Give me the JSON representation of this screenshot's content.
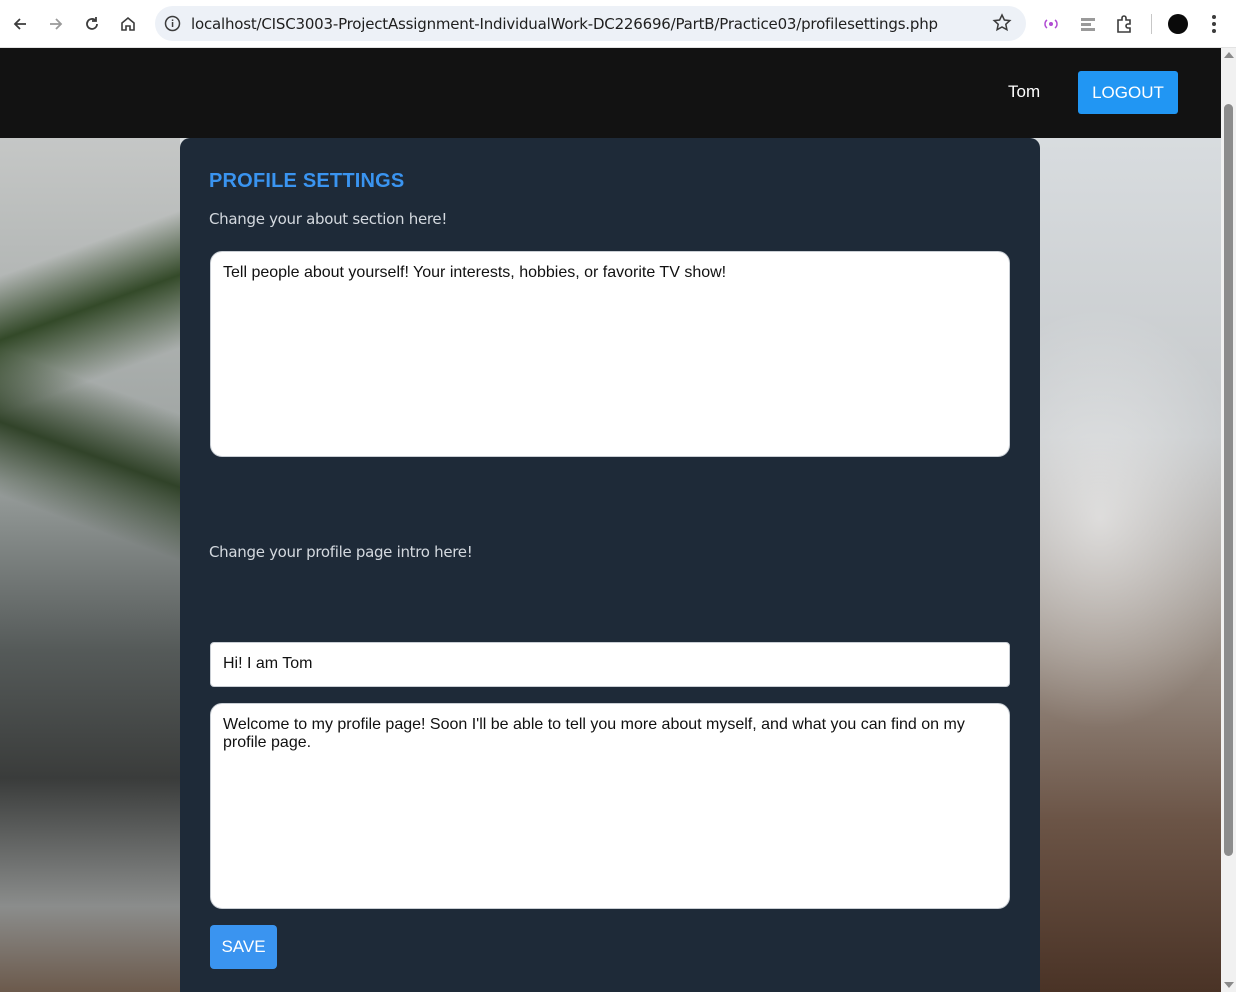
{
  "browser": {
    "url": "localhost/CISC3003-ProjectAssignment-IndividualWork-DC226696/PartB/Practice03/profilesettings.php",
    "icons": [
      "back-icon",
      "forward-icon",
      "reload-icon",
      "home-icon",
      "site-info-icon",
      "bookmark-star-icon",
      "media-cast-icon",
      "extension-puzzle-icon",
      "profile-avatar-icon",
      "menu-kebab-icon"
    ]
  },
  "header": {
    "username": "Tom",
    "logout_label": "LOGOUT"
  },
  "settings": {
    "title": "PROFILE SETTINGS",
    "about_label": "Change your about section here!",
    "about_text": "Tell people about yourself! Your interests, hobbies, or favorite TV show!",
    "intro_label": "Change your profile page intro here!",
    "intro_title": "Hi! I am Tom",
    "intro_text": "Welcome to my profile page! Soon I'll be able to tell you more about myself, and what you can find on my profile page.",
    "save_label": "SAVE"
  },
  "colors": {
    "topbar": "#121212",
    "card": "#1e2a38",
    "accent": "#3a94f0",
    "logout": "#2196f3"
  }
}
